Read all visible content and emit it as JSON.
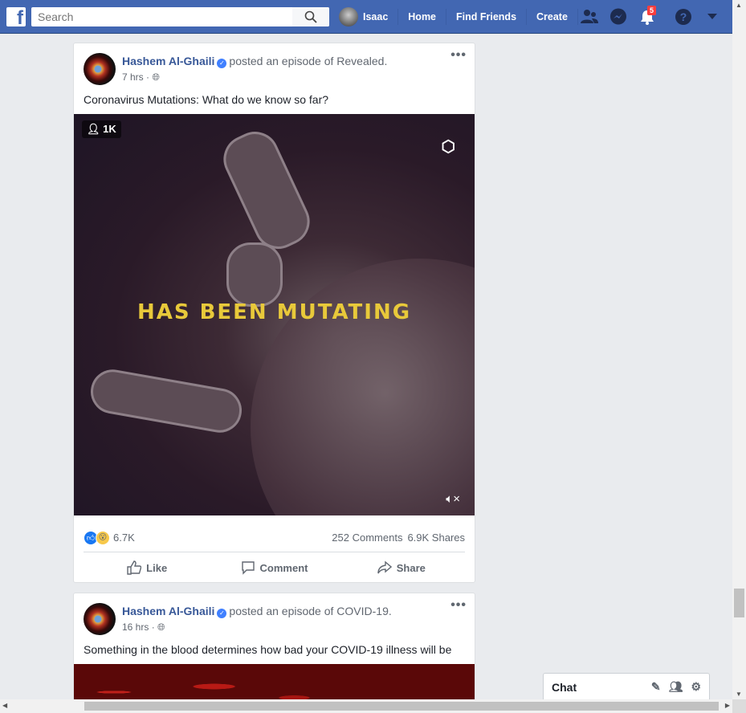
{
  "topbar": {
    "search_placeholder": "Search",
    "user": "Isaac",
    "nav": [
      "Home",
      "Find Friends",
      "Create"
    ],
    "notifications_count": "5",
    "brand_color": "#4267b2"
  },
  "posts": [
    {
      "author": "Hashem Al-Ghaili",
      "action": "posted an episode of Revealed.",
      "time": "7 hrs",
      "privacy_icon": "globe-icon",
      "text": "Coronavirus Mutations: What do we know so far?",
      "video": {
        "viewers": "1K",
        "caption": "HAS BEEN MUTATING",
        "muted": true
      },
      "reactions": "6.7K",
      "comments": "252 Comments",
      "shares": "6.9K Shares"
    },
    {
      "author": "Hashem Al-Ghaili",
      "action": "posted an episode of COVID-19.",
      "time": "16 hrs",
      "privacy_icon": "globe-icon",
      "text": "Something in the blood determines how bad your COVID-19 illness will be"
    }
  ],
  "actions": {
    "like": "Like",
    "comment": "Comment",
    "share": "Share"
  },
  "chat": {
    "label": "Chat"
  }
}
